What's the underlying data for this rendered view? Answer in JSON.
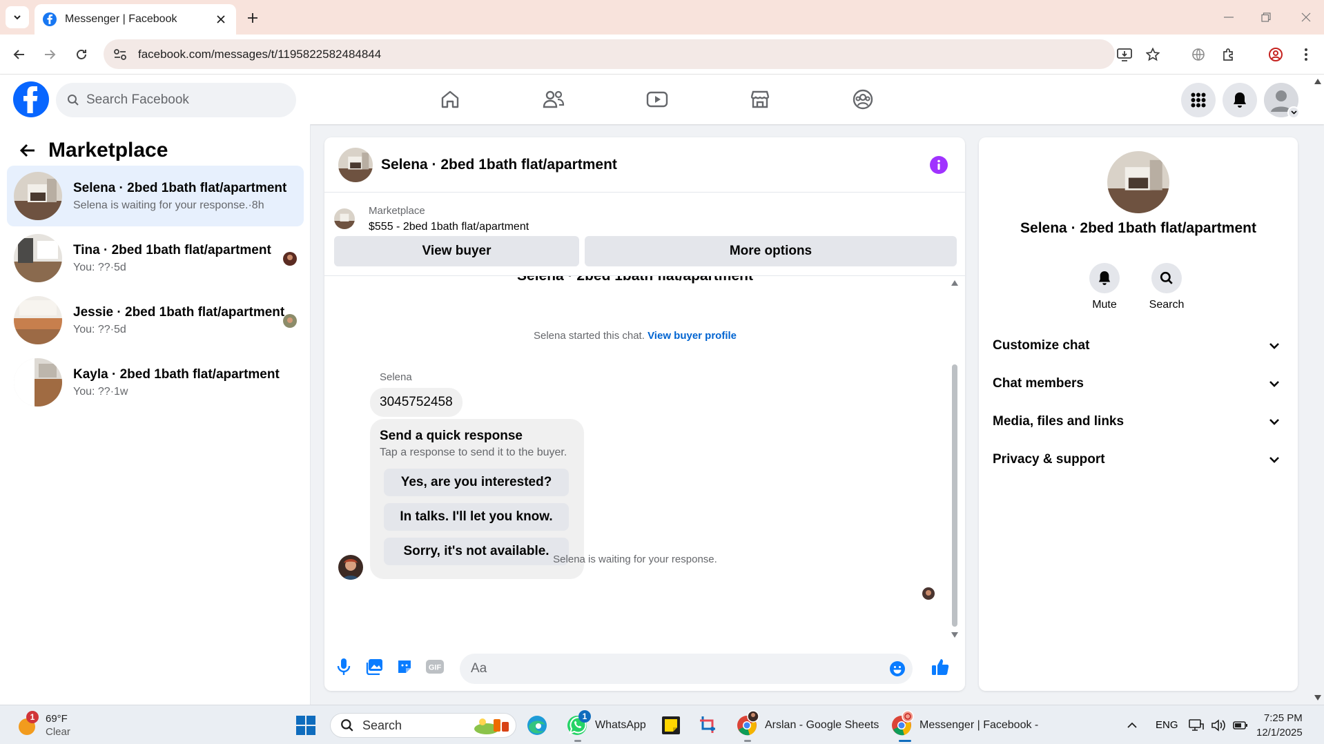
{
  "browser": {
    "tab_title": "Messenger | Facebook",
    "url": "facebook.com/messages/t/1195822582484844"
  },
  "facebook": {
    "search_placeholder": "Search Facebook"
  },
  "sidebar": {
    "title": "Marketplace",
    "conversations": [
      {
        "name": "Selena · 2bed 1bath flat/apartment",
        "preview": "Selena is waiting for your response.·8h",
        "active": true
      },
      {
        "name": "Tina · 2bed 1bath flat/apartment",
        "preview": "You: ??·5d",
        "active": false
      },
      {
        "name": "Jessie · 2bed 1bath flat/apartment",
        "preview": "You: ??·5d",
        "active": false
      },
      {
        "name": "Kayla · 2bed 1bath flat/apartment",
        "preview": "You: ??·1w",
        "active": false
      }
    ]
  },
  "chat": {
    "title": "Selena · 2bed 1bath flat/apartment",
    "listing_label": "Marketplace",
    "listing_price": "$555 - 2bed 1bath flat/apartment",
    "view_buyer_label": "View buyer",
    "more_options_label": "More options",
    "started_text": "Selena started this chat.",
    "view_profile_link": "View buyer profile",
    "sender_name": "Selena",
    "phone_message": "3045752458",
    "quick_response_title": "Send a quick response",
    "quick_response_subtitle": "Tap a response to send it to the buyer.",
    "quick_responses": [
      "Yes, are you interested?",
      "In talks. I'll let you know.",
      "Sorry, it's not available."
    ],
    "waiting_text": "Selena is waiting for your response.",
    "composer_placeholder": "Aa"
  },
  "details_panel": {
    "name": "Selena · 2bed 1bath flat/apartment",
    "mute_label": "Mute",
    "search_label": "Search",
    "sections": [
      "Customize chat",
      "Chat members",
      "Media, files and links",
      "Privacy & support"
    ]
  },
  "taskbar": {
    "weather_temp": "69°F",
    "weather_desc": "Clear",
    "weather_badge": "1",
    "search_label": "Search",
    "whatsapp_label": "WhatsApp",
    "whatsapp_badge": "1",
    "sheets_label": "Arslan - Google Sheets",
    "messenger_label": "Messenger | Facebook -",
    "language": "ENG",
    "time": "7:25 PM",
    "date": "12/1/2025"
  },
  "colors": {
    "fb_blue": "#0866ff",
    "link_blue": "#0064d1",
    "accent_purple": "#a033ff",
    "composer_blue": "#0a7cff",
    "active_conv_bg": "#e7f0fd"
  }
}
